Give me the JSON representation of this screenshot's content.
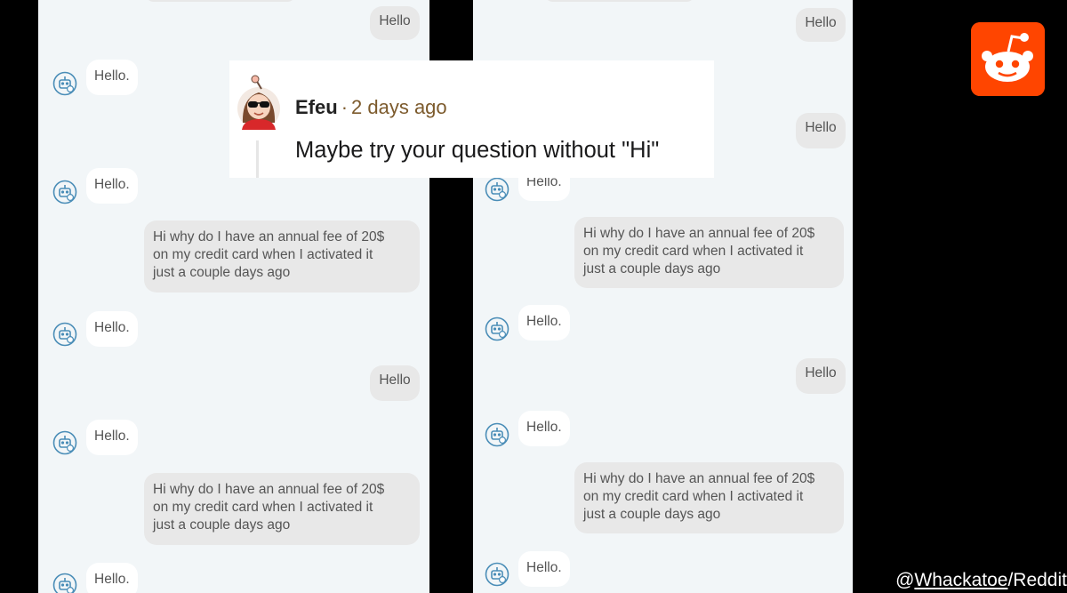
{
  "left_panel": {
    "messages": [
      {
        "sender": "user",
        "text": "Hello"
      },
      {
        "sender": "bot",
        "text": "Hello."
      },
      {
        "sender": "bot",
        "text": "Hello."
      },
      {
        "sender": "user",
        "text": "Hi why do I have an annual fee of 20$\non my credit card when I activated it\njust a couple days ago"
      },
      {
        "sender": "bot",
        "text": "Hello."
      },
      {
        "sender": "user",
        "text": "Hello"
      },
      {
        "sender": "bot",
        "text": "Hello."
      },
      {
        "sender": "user",
        "text": "Hi why do I have an annual fee of 20$\non my credit card when I activated it\njust a couple days ago"
      },
      {
        "sender": "bot",
        "text": "Hello."
      }
    ]
  },
  "right_panel": {
    "messages": [
      {
        "sender": "user",
        "text": "Hello"
      },
      {
        "sender": "user",
        "text": "Hello"
      },
      {
        "sender": "bot",
        "text": "Hello."
      },
      {
        "sender": "user",
        "text": "Hi why do I have an annual fee of 20$\non my credit card when I activated it\njust a couple days ago"
      },
      {
        "sender": "bot",
        "text": "Hello."
      },
      {
        "sender": "user",
        "text": "Hello"
      },
      {
        "sender": "bot",
        "text": "Hello."
      },
      {
        "sender": "user",
        "text": "Hi why do I have an annual fee of 20$\non my credit card when I activated it\njust a couple days ago"
      },
      {
        "sender": "bot",
        "text": "Hello."
      }
    ]
  },
  "comment": {
    "author": "Efeu",
    "separator": "·",
    "time": "2 days ago",
    "body": "Maybe try your question without \"Hi\""
  },
  "credit": {
    "prefix": "@",
    "handle": "Whackatoe",
    "suffix": "/Reddit"
  },
  "colors": {
    "chat_background": "#f2f6f8",
    "user_bubble": "#e8e8e8",
    "bot_bubble": "#ffffff",
    "bot_icon": "#4a8db7",
    "reddit_orange": "#ff4500"
  },
  "icons": {
    "bot": "robot-chat-icon",
    "reddit": "reddit-snoo-logo"
  }
}
